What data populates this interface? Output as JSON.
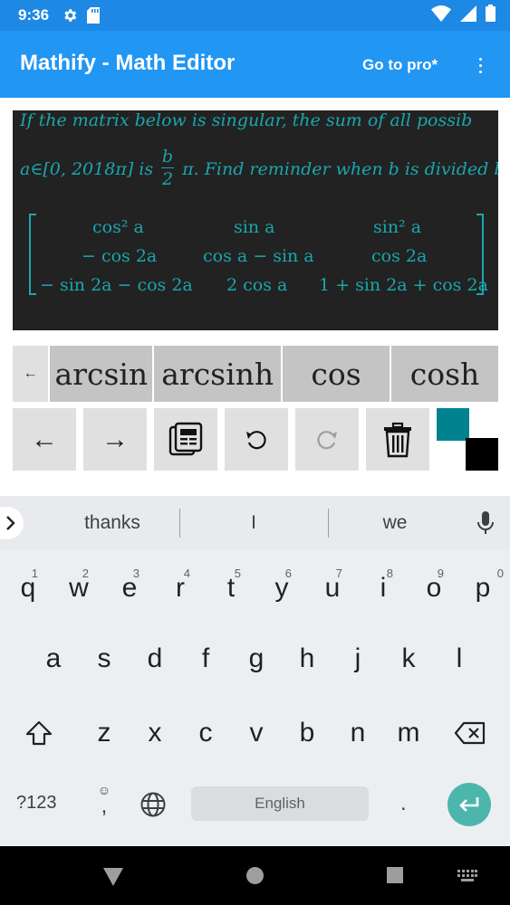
{
  "status_bar": {
    "time": "9:36",
    "icons": [
      "settings-icon",
      "sd-card-icon",
      "wifi-icon",
      "signal-icon",
      "battery-icon"
    ]
  },
  "app_bar": {
    "title": "Mathify - Math Editor",
    "go_pro": "Go to pro*",
    "menu_icon": "more-vert-icon"
  },
  "math_preview": {
    "line1": "If the matrix below is singular, the sum of all possib",
    "line2_prefix": "a∈[0, 2018π]  is ",
    "frac_num": "b",
    "frac_den": "2",
    "line2_suffix": "π. Find reminder when b is divided b",
    "matrix": [
      [
        "cos² a",
        "sin a",
        "sin² a"
      ],
      [
        "− cos 2a",
        "cos a − sin a",
        "cos 2a"
      ],
      [
        "− sin 2a − cos 2a",
        "2 cos a",
        "1 + sin 2a + cos 2a"
      ]
    ],
    "text_color": "#19a7ad",
    "background": "#222222"
  },
  "function_row": {
    "back": "←",
    "items": [
      "arcsin",
      "arcsinh",
      "cos",
      "cosh"
    ]
  },
  "tools": {
    "left_arrow": "←",
    "right_arrow": "→",
    "icons": [
      "left-arrow-icon",
      "right-arrow-icon",
      "clipboard-icon",
      "undo-icon",
      "redo-icon",
      "trash-icon"
    ],
    "colors": [
      "#00838f",
      "#000000"
    ]
  },
  "keyboard": {
    "suggestions": [
      "thanks",
      "I",
      "we"
    ],
    "row1": [
      {
        "k": "q",
        "n": "1"
      },
      {
        "k": "w",
        "n": "2"
      },
      {
        "k": "e",
        "n": "3"
      },
      {
        "k": "r",
        "n": "4"
      },
      {
        "k": "t",
        "n": "5"
      },
      {
        "k": "y",
        "n": "6"
      },
      {
        "k": "u",
        "n": "7"
      },
      {
        "k": "i",
        "n": "8"
      },
      {
        "k": "o",
        "n": "9"
      },
      {
        "k": "p",
        "n": "0"
      }
    ],
    "row2": [
      "a",
      "s",
      "d",
      "f",
      "g",
      "h",
      "j",
      "k",
      "l"
    ],
    "row3": [
      "z",
      "x",
      "c",
      "v",
      "b",
      "n",
      "m"
    ],
    "symbols": "?123",
    "emoji_comma": ",",
    "space": "English",
    "period": "."
  }
}
